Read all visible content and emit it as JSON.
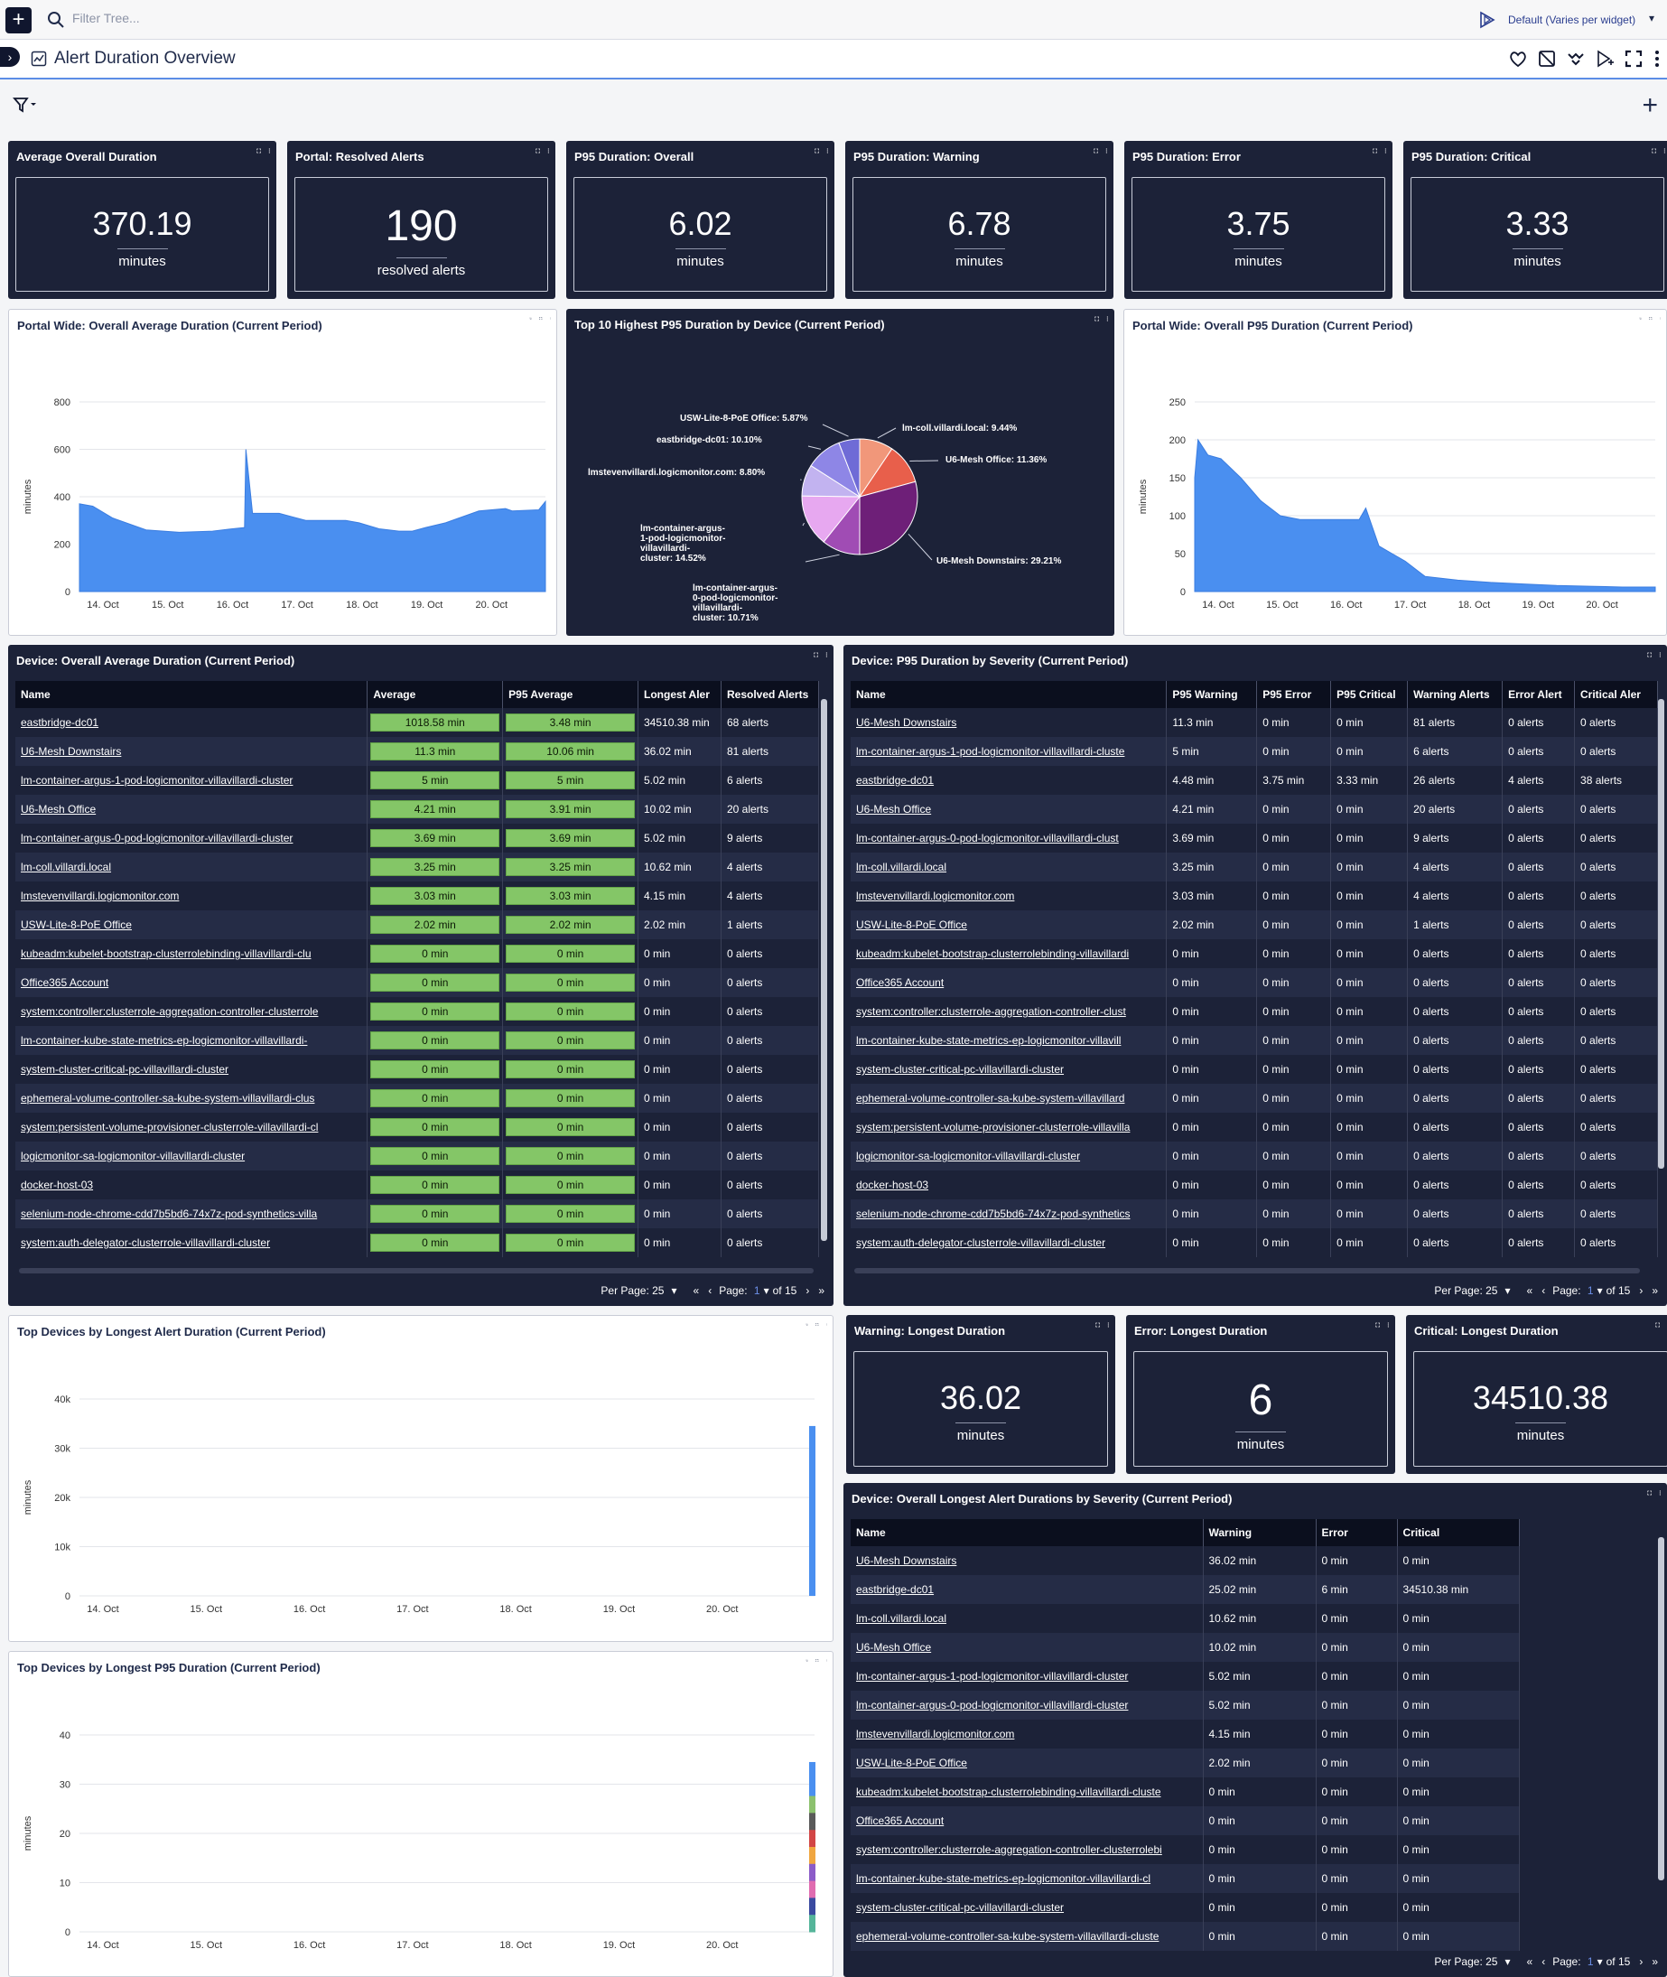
{
  "topbar": {
    "filter_placeholder": "Filter Tree...",
    "timezone_label": "Default (Varies per widget)"
  },
  "dashboard": {
    "title": "Alert Duration Overview"
  },
  "colors": {
    "accent": "#4a8ff0",
    "widget_dark": "#1c2238",
    "green_cell": "#84c667"
  },
  "big_numbers": [
    {
      "title": "Average Overall Duration",
      "value": "370.19",
      "unit": "minutes"
    },
    {
      "title": "Portal: Resolved Alerts",
      "value": "190",
      "unit": "resolved alerts"
    },
    {
      "title": "P95 Duration: Overall",
      "value": "6.02",
      "unit": "minutes"
    },
    {
      "title": "P95 Duration: Warning",
      "value": "6.78",
      "unit": "minutes"
    },
    {
      "title": "P95 Duration: Error",
      "value": "3.75",
      "unit": "minutes"
    },
    {
      "title": "P95 Duration: Critical",
      "value": "3.33",
      "unit": "minutes"
    }
  ],
  "big_numbers_2": [
    {
      "title": "Warning: Longest Duration",
      "value": "36.02",
      "unit": "minutes"
    },
    {
      "title": "Error: Longest Duration",
      "value": "6",
      "unit": "minutes"
    },
    {
      "title": "Critical: Longest Duration",
      "value": "34510.38",
      "unit": "minutes"
    }
  ],
  "charts": {
    "avg": {
      "title": "Portal Wide: Overall Average Duration (Current Period)"
    },
    "pie": {
      "title": "Top 10 Highest P95 Duration by Device (Current Period)"
    },
    "p95": {
      "title": "Portal Wide: Overall P95 Duration (Current Period)"
    },
    "longest": {
      "title": "Top Devices by Longest Alert Duration (Current Period)"
    },
    "longest_p95": {
      "title": "Top Devices by Longest P95 Duration (Current Period)"
    }
  },
  "chart_data": [
    {
      "type": "area",
      "title": "Portal Wide: Overall Average Duration (Current Period)",
      "ylabel": "minutes",
      "ylim": [
        0,
        800
      ],
      "yticks": [
        "0",
        "200",
        "400",
        "600",
        "800"
      ],
      "xticks": [
        "14. Oct",
        "15. Oct",
        "16. Oct",
        "17. Oct",
        "18. Oct",
        "19. Oct",
        "20. Oct"
      ],
      "x": [
        0,
        0.2,
        0.5,
        1,
        1.5,
        2,
        2.3,
        2.48,
        2.5,
        2.6,
        3,
        3.2,
        3.4,
        4,
        4.2,
        4.5,
        4.8,
        5,
        5.2,
        5.5,
        6,
        6.4,
        6.5,
        6.9,
        7.0
      ],
      "values": [
        370,
        360,
        310,
        260,
        250,
        255,
        265,
        270,
        600,
        330,
        330,
        315,
        300,
        300,
        290,
        265,
        255,
        255,
        270,
        290,
        340,
        350,
        340,
        345,
        380
      ]
    },
    {
      "type": "pie",
      "title": "Top 10 Highest P95 Duration by Device (Current Period)",
      "labels": [
        "lm-coll.villardi.local: 9.44%",
        "U6-Mesh Office: 11.36%",
        "U6-Mesh Downstairs: 29.21%",
        "lm-container-argus-0-pod-logicmonitor-villavillardi-cluster: 10.71%",
        "lm-container-argus-1-pod-logicmonitor-villavillardi-cluster: 14.52%",
        "lmstevenvillardi.logicmonitor.com: 8.80%",
        "eastbridge-dc01: 10.10%",
        "USW-Lite-8-PoE Office: 5.87%"
      ],
      "values": [
        9.44,
        11.36,
        29.21,
        10.71,
        14.52,
        8.8,
        10.1,
        5.87
      ]
    },
    {
      "type": "area",
      "title": "Portal Wide: Overall P95 Duration (Current Period)",
      "ylabel": "minutes",
      "ylim": [
        0,
        250
      ],
      "yticks": [
        "0",
        "50",
        "100",
        "150",
        "200",
        "250"
      ],
      "xticks": [
        "14. Oct",
        "15. Oct",
        "16. Oct",
        "17. Oct",
        "18. Oct",
        "19. Oct",
        "20. Oct"
      ],
      "x": [
        0,
        0.05,
        0.2,
        0.4,
        0.7,
        1.0,
        1.3,
        1.6,
        2.0,
        2.5,
        2.6,
        2.8,
        3.0,
        3.2,
        3.5,
        4.0,
        4.5,
        5.0,
        5.5,
        6.0,
        6.5,
        7.0
      ],
      "values": [
        150,
        200,
        180,
        175,
        150,
        120,
        100,
        95,
        95,
        95,
        110,
        60,
        50,
        40,
        20,
        15,
        12,
        10,
        8,
        7,
        6,
        6
      ]
    },
    {
      "type": "bar",
      "title": "Top Devices by Longest Alert Duration (Current Period)",
      "ylabel": "minutes",
      "ylim": [
        0,
        40000
      ],
      "yticks": [
        "0",
        "10k",
        "20k",
        "30k",
        "40k"
      ],
      "xticks": [
        "14. Oct",
        "15. Oct",
        "16. Oct",
        "17. Oct",
        "18. Oct",
        "19. Oct",
        "20. Oct"
      ],
      "series": [
        {
          "values": [
            34510.38
          ]
        }
      ]
    },
    {
      "type": "bar",
      "title": "Top Devices by Longest P95 Duration (Current Period)",
      "ylabel": "minutes",
      "ylim": [
        0,
        40
      ],
      "yticks": [
        "0",
        "10",
        "20",
        "30",
        "40"
      ],
      "xticks": [
        "14. Oct",
        "15. Oct",
        "16. Oct",
        "17. Oct",
        "18. Oct",
        "19. Oct",
        "20. Oct"
      ],
      "series": [
        {
          "values": [
            34.5
          ]
        }
      ]
    }
  ],
  "table1": {
    "title": "Device: Overall Average Duration (Current Period)",
    "columns": [
      "Name",
      "Average",
      "P95 Average",
      "Longest Aler",
      "Resolved Alerts"
    ],
    "rows": [
      [
        "eastbridge-dc01",
        "1018.58 min",
        "3.48 min",
        "34510.38 min",
        "68 alerts"
      ],
      [
        "U6-Mesh Downstairs",
        "11.3 min",
        "10.06 min",
        "36.02 min",
        "81 alerts"
      ],
      [
        "lm-container-argus-1-pod-logicmonitor-villavillardi-cluster",
        "5 min",
        "5 min",
        "5.02 min",
        "6 alerts"
      ],
      [
        "U6-Mesh Office",
        "4.21 min",
        "3.91 min",
        "10.02 min",
        "20 alerts"
      ],
      [
        "lm-container-argus-0-pod-logicmonitor-villavillardi-cluster",
        "3.69 min",
        "3.69 min",
        "5.02 min",
        "9 alerts"
      ],
      [
        "lm-coll.villardi.local",
        "3.25 min",
        "3.25 min",
        "10.62 min",
        "4 alerts"
      ],
      [
        "lmstevenvillardi.logicmonitor.com",
        "3.03 min",
        "3.03 min",
        "4.15 min",
        "4 alerts"
      ],
      [
        "USW-Lite-8-PoE Office",
        "2.02 min",
        "2.02 min",
        "2.02 min",
        "1 alerts"
      ],
      [
        "kubeadm:kubelet-bootstrap-clusterrolebinding-villavillardi-clu",
        "0 min",
        "0 min",
        "0 min",
        "0 alerts"
      ],
      [
        "Office365 Account",
        "0 min",
        "0 min",
        "0 min",
        "0 alerts"
      ],
      [
        "system:controller:clusterrole-aggregation-controller-clusterrole",
        "0 min",
        "0 min",
        "0 min",
        "0 alerts"
      ],
      [
        "lm-container-kube-state-metrics-ep-logicmonitor-villavillardi-",
        "0 min",
        "0 min",
        "0 min",
        "0 alerts"
      ],
      [
        "system-cluster-critical-pc-villavillardi-cluster",
        "0 min",
        "0 min",
        "0 min",
        "0 alerts"
      ],
      [
        "ephemeral-volume-controller-sa-kube-system-villavillardi-clus",
        "0 min",
        "0 min",
        "0 min",
        "0 alerts"
      ],
      [
        "system:persistent-volume-provisioner-clusterrole-villavillardi-cl",
        "0 min",
        "0 min",
        "0 min",
        "0 alerts"
      ],
      [
        "logicmonitor-sa-logicmonitor-villavillardi-cluster",
        "0 min",
        "0 min",
        "0 min",
        "0 alerts"
      ],
      [
        "docker-host-03",
        "0 min",
        "0 min",
        "0 min",
        "0 alerts"
      ],
      [
        "selenium-node-chrome-cdd7b5bd6-74x7z-pod-synthetics-villa",
        "0 min",
        "0 min",
        "0 min",
        "0 alerts"
      ],
      [
        "system:auth-delegator-clusterrole-villavillardi-cluster",
        "0 min",
        "0 min",
        "0 min",
        "0 alerts"
      ]
    ],
    "pager": {
      "per_page_label": "Per Page: 25",
      "page_label": "Page:",
      "page": "1",
      "of": "of 15"
    }
  },
  "table2": {
    "title": "Device: P95 Duration by Severity (Current Period)",
    "columns": [
      "Name",
      "P95 Warning",
      "P95 Error",
      "P95 Critical",
      "Warning Alerts",
      "Error Alert",
      "Critical Aler"
    ],
    "rows": [
      [
        "U6-Mesh Downstairs",
        "11.3 min",
        "0 min",
        "0 min",
        "81 alerts",
        "0 alerts",
        "0 alerts"
      ],
      [
        "lm-container-argus-1-pod-logicmonitor-villavillardi-cluste",
        "5 min",
        "0 min",
        "0 min",
        "6 alerts",
        "0 alerts",
        "0 alerts"
      ],
      [
        "eastbridge-dc01",
        "4.48 min",
        "3.75 min",
        "3.33 min",
        "26 alerts",
        "4 alerts",
        "38 alerts"
      ],
      [
        "U6-Mesh Office",
        "4.21 min",
        "0 min",
        "0 min",
        "20 alerts",
        "0 alerts",
        "0 alerts"
      ],
      [
        "lm-container-argus-0-pod-logicmonitor-villavillardi-clust",
        "3.69 min",
        "0 min",
        "0 min",
        "9 alerts",
        "0 alerts",
        "0 alerts"
      ],
      [
        "lm-coll.villardi.local",
        "3.25 min",
        "0 min",
        "0 min",
        "4 alerts",
        "0 alerts",
        "0 alerts"
      ],
      [
        "lmstevenvillardi.logicmonitor.com",
        "3.03 min",
        "0 min",
        "0 min",
        "4 alerts",
        "0 alerts",
        "0 alerts"
      ],
      [
        "USW-Lite-8-PoE Office",
        "2.02 min",
        "0 min",
        "0 min",
        "1 alerts",
        "0 alerts",
        "0 alerts"
      ],
      [
        "kubeadm:kubelet-bootstrap-clusterrolebinding-villavillardi",
        "0 min",
        "0 min",
        "0 min",
        "0 alerts",
        "0 alerts",
        "0 alerts"
      ],
      [
        "Office365 Account",
        "0 min",
        "0 min",
        "0 min",
        "0 alerts",
        "0 alerts",
        "0 alerts"
      ],
      [
        "system:controller:clusterrole-aggregation-controller-clust",
        "0 min",
        "0 min",
        "0 min",
        "0 alerts",
        "0 alerts",
        "0 alerts"
      ],
      [
        "lm-container-kube-state-metrics-ep-logicmonitor-villavill",
        "0 min",
        "0 min",
        "0 min",
        "0 alerts",
        "0 alerts",
        "0 alerts"
      ],
      [
        "system-cluster-critical-pc-villavillardi-cluster",
        "0 min",
        "0 min",
        "0 min",
        "0 alerts",
        "0 alerts",
        "0 alerts"
      ],
      [
        "ephemeral-volume-controller-sa-kube-system-villavillard",
        "0 min",
        "0 min",
        "0 min",
        "0 alerts",
        "0 alerts",
        "0 alerts"
      ],
      [
        "system:persistent-volume-provisioner-clusterrole-villavilla",
        "0 min",
        "0 min",
        "0 min",
        "0 alerts",
        "0 alerts",
        "0 alerts"
      ],
      [
        "logicmonitor-sa-logicmonitor-villavillardi-cluster",
        "0 min",
        "0 min",
        "0 min",
        "0 alerts",
        "0 alerts",
        "0 alerts"
      ],
      [
        "docker-host-03",
        "0 min",
        "0 min",
        "0 min",
        "0 alerts",
        "0 alerts",
        "0 alerts"
      ],
      [
        "selenium-node-chrome-cdd7b5bd6-74x7z-pod-synthetics",
        "0 min",
        "0 min",
        "0 min",
        "0 alerts",
        "0 alerts",
        "0 alerts"
      ],
      [
        "system:auth-delegator-clusterrole-villavillardi-cluster",
        "0 min",
        "0 min",
        "0 min",
        "0 alerts",
        "0 alerts",
        "0 alerts"
      ]
    ],
    "pager": {
      "per_page_label": "Per Page: 25",
      "page_label": "Page:",
      "page": "1",
      "of": "of 15"
    }
  },
  "table3": {
    "title": "Device: Overall Longest Alert Durations by Severity (Current Period)",
    "columns": [
      "Name",
      "Warning",
      "Error",
      "Critical"
    ],
    "rows": [
      [
        "U6-Mesh Downstairs",
        "36.02 min",
        "0 min",
        "0 min"
      ],
      [
        "eastbridge-dc01",
        "25.02 min",
        "6 min",
        "34510.38 min"
      ],
      [
        "lm-coll.villardi.local",
        "10.62 min",
        "0 min",
        "0 min"
      ],
      [
        "U6-Mesh Office",
        "10.02 min",
        "0 min",
        "0 min"
      ],
      [
        "lm-container-argus-1-pod-logicmonitor-villavillardi-cluster",
        "5.02 min",
        "0 min",
        "0 min"
      ],
      [
        "lm-container-argus-0-pod-logicmonitor-villavillardi-cluster",
        "5.02 min",
        "0 min",
        "0 min"
      ],
      [
        "lmstevenvillardi.logicmonitor.com",
        "4.15 min",
        "0 min",
        "0 min"
      ],
      [
        "USW-Lite-8-PoE Office",
        "2.02 min",
        "0 min",
        "0 min"
      ],
      [
        "kubeadm:kubelet-bootstrap-clusterrolebinding-villavillardi-cluste",
        "0 min",
        "0 min",
        "0 min"
      ],
      [
        "Office365 Account",
        "0 min",
        "0 min",
        "0 min"
      ],
      [
        "system:controller:clusterrole-aggregation-controller-clusterrolebi",
        "0 min",
        "0 min",
        "0 min"
      ],
      [
        "lm-container-kube-state-metrics-ep-logicmonitor-villavillardi-cl",
        "0 min",
        "0 min",
        "0 min"
      ],
      [
        "system-cluster-critical-pc-villavillardi-cluster",
        "0 min",
        "0 min",
        "0 min"
      ],
      [
        "ephemeral-volume-controller-sa-kube-system-villavillardi-cluste",
        "0 min",
        "0 min",
        "0 min"
      ]
    ],
    "pager": {
      "per_page_label": "Per Page: 25",
      "page_label": "Page:",
      "page": "1",
      "of": "of 15"
    }
  }
}
